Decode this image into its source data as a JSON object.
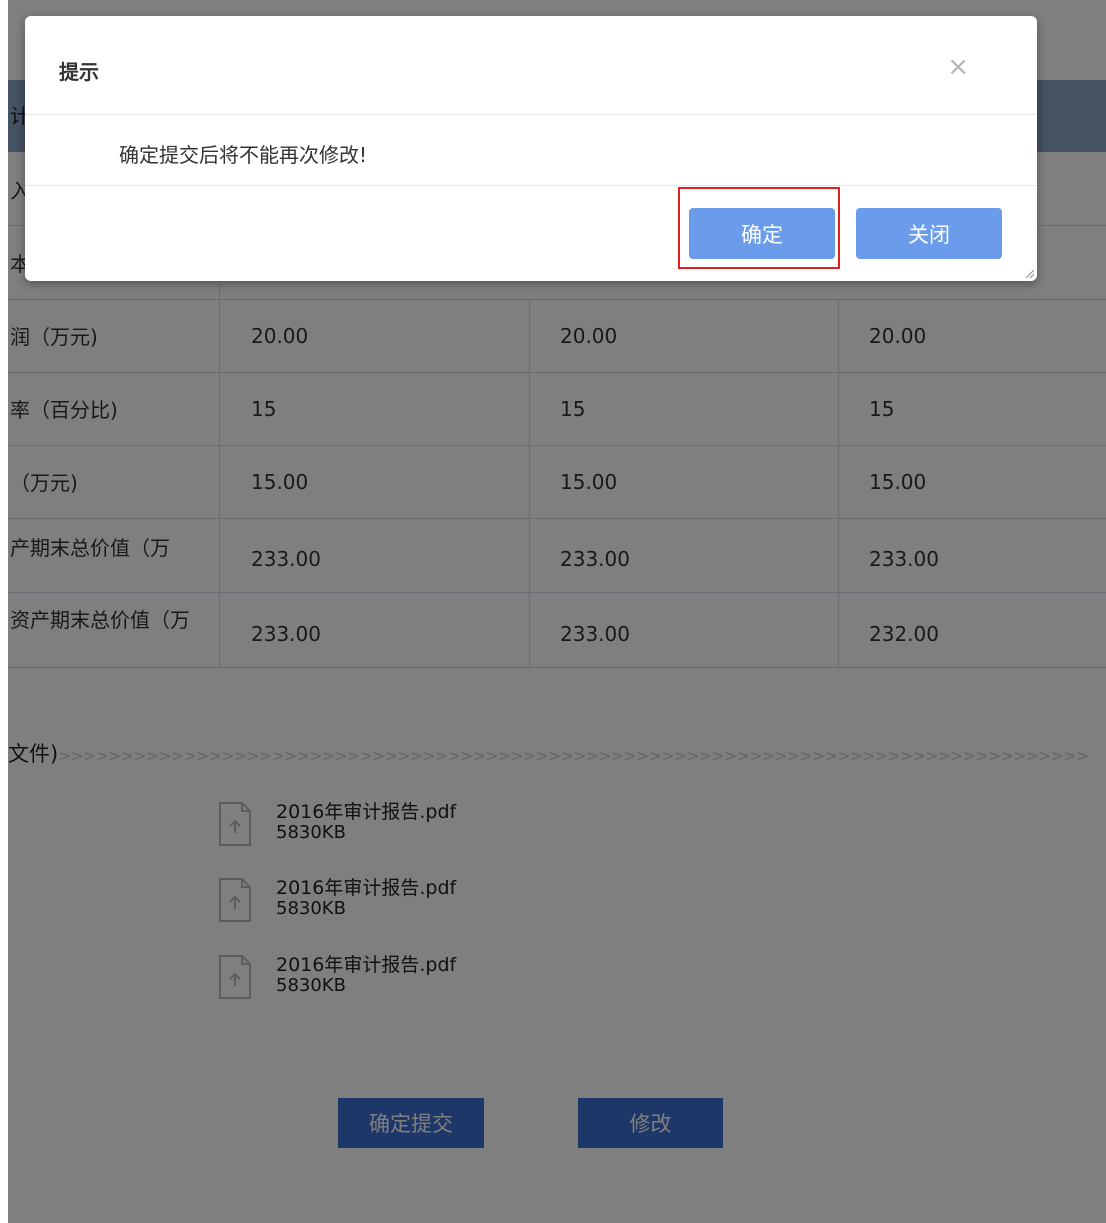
{
  "table": {
    "header_partial": "计",
    "rows_hidden": [
      {
        "label": "入"
      },
      {
        "label": "本"
      }
    ],
    "rows": [
      {
        "label": "润（万元)",
        "v1": "20.00",
        "v2": "20.00",
        "v3": "20.00"
      },
      {
        "label": "率（百分比)",
        "v1": "15",
        "v2": "15",
        "v3": "15"
      },
      {
        "label": "（万元)",
        "v1": "15.00",
        "v2": "15.00",
        "v3": "15.00"
      },
      {
        "label": "产期末总价值（万",
        "v1": "233.00",
        "v2": "233.00",
        "v3": "233.00"
      },
      {
        "label": "资产期末总价值（万",
        "v1": "233.00",
        "v2": "233.00",
        "v3": "232.00"
      }
    ]
  },
  "attachments": {
    "section_title": "文件)",
    "chevrons": ">>>>>>>>>>>>>>>>>>>>>>>>>>>>>>>>>>>>>>>>>>>>>>>>>>>>>>>>>>>>>>>>>>>>>>>>>>>>>>>>>>",
    "files": [
      {
        "name": "2016年审计报告.pdf",
        "size": "5830KB",
        "icon": "file-upload-icon"
      },
      {
        "name": "2016年审计报告.pdf",
        "size": "5830KB",
        "icon": "file-upload-icon"
      },
      {
        "name": "2016年审计报告.pdf",
        "size": "5830KB",
        "icon": "file-upload-icon"
      }
    ]
  },
  "actions": {
    "submit_label": "确定提交",
    "edit_label": "修改"
  },
  "dialog": {
    "title": "提示",
    "close_icon": "close-icon",
    "message": "确定提交后将不能再次修改!",
    "confirm_label": "确定",
    "close_label": "关闭"
  },
  "colors": {
    "primary_button": "#3a6ed0",
    "dialog_button": "#6b9ceb",
    "highlight": "#e02020",
    "header_band": "#8aa4c2"
  }
}
